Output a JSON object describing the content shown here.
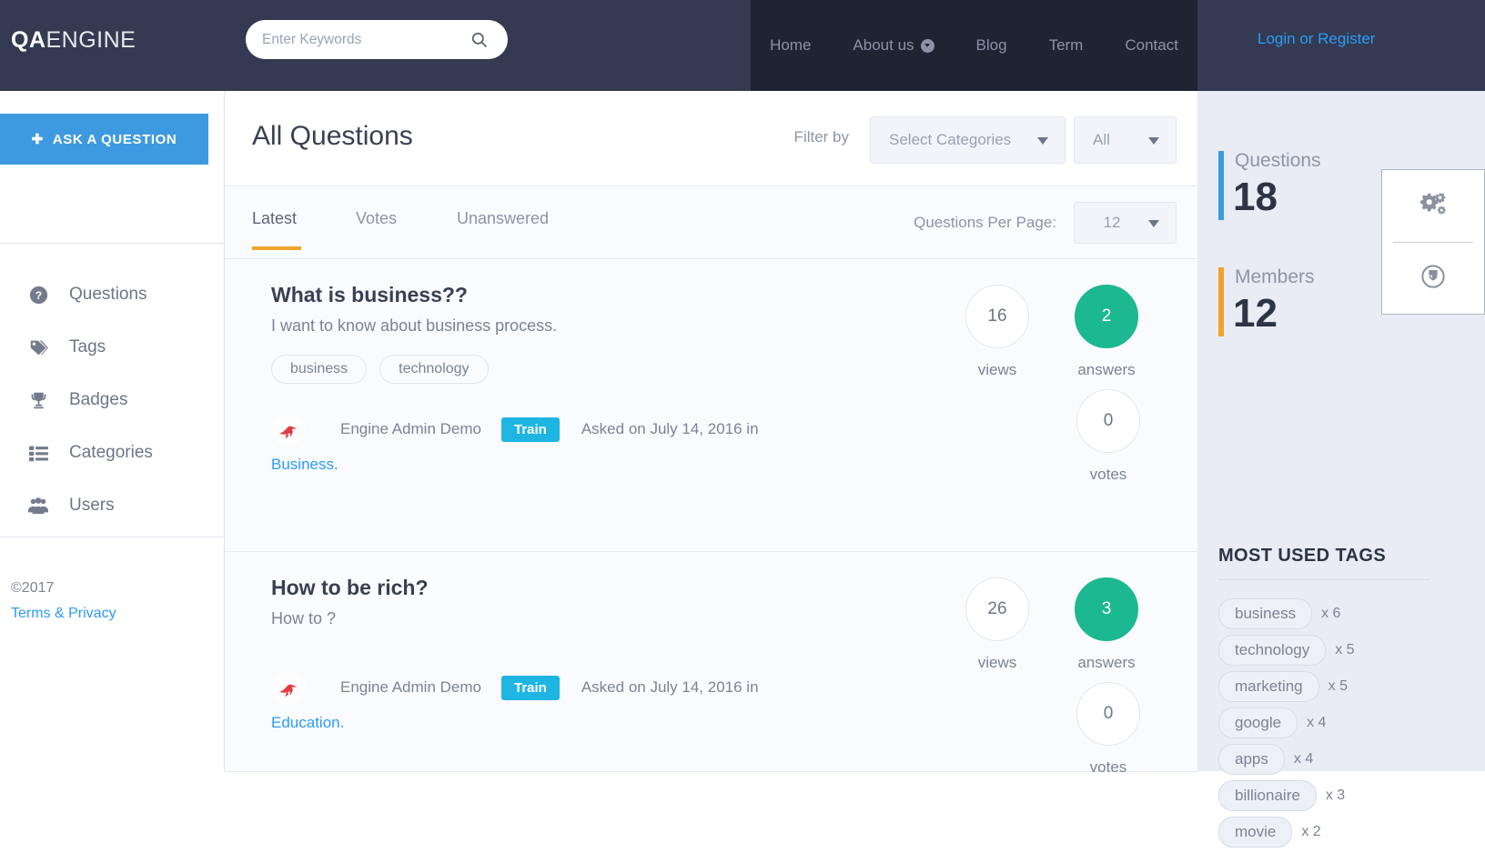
{
  "header": {
    "logo_qa": "QA",
    "logo_engine": "ENGINE",
    "search_placeholder": "Enter Keywords",
    "search_value": "",
    "search_icon": "search-icon",
    "nav": [
      {
        "label": "Home",
        "has_caret": false
      },
      {
        "label": "About us",
        "has_caret": true
      },
      {
        "label": "Blog",
        "has_caret": false
      },
      {
        "label": "Term",
        "has_caret": false
      },
      {
        "label": "Contact",
        "has_caret": false
      }
    ],
    "login_label": "Login or Register",
    "bg_color": "#343a51",
    "nav_bg_color": "#1f2433",
    "login_color": "#2b9cf5"
  },
  "sidebar": {
    "ask_button": "ASK A QUESTION",
    "ask_plus": "✚",
    "ask_color": "#3d9ae0",
    "items": [
      {
        "label": "Questions",
        "icon": "question-circle-icon"
      },
      {
        "label": "Tags",
        "icon": "tag-icon"
      },
      {
        "label": "Badges",
        "icon": "trophy-icon"
      },
      {
        "label": "Categories",
        "icon": "list-icon"
      },
      {
        "label": "Users",
        "icon": "users-icon"
      }
    ],
    "copyright": "©2017",
    "terms": "Terms & Privacy"
  },
  "main": {
    "title": "All Questions",
    "filter_by_label": "Filter by",
    "select_categories": "Select Categories",
    "select_all": "All",
    "tabs": [
      {
        "label": "Latest",
        "active": true
      },
      {
        "label": "Votes",
        "active": false
      },
      {
        "label": "Unanswered",
        "active": false
      }
    ],
    "active_tab_color": "#f0a42b",
    "questions_per_page_label": "Questions Per Page:",
    "questions_per_page_value": "12",
    "questions": [
      {
        "title": "What is business??",
        "excerpt": "I want to know about business process.",
        "tags": [
          "business",
          "technology"
        ],
        "author": "Engine Admin Demo",
        "badge": "Train",
        "asked": "Asked on July 14, 2016 in",
        "category": "Business.",
        "views": "16",
        "views_label": "views",
        "answers": "2",
        "answers_label": "answers",
        "votes": "0",
        "votes_label": "votes",
        "answers_highlight": true
      },
      {
        "title": "How to be rich?",
        "excerpt": "How to ?",
        "tags": [],
        "author": "Engine Admin Demo",
        "badge": "Train",
        "asked": "Asked on July 14, 2016 in",
        "category": "Education.",
        "views": "26",
        "views_label": "views",
        "answers": "3",
        "answers_label": "answers",
        "votes": "0",
        "votes_label": "votes",
        "answers_highlight": true
      }
    ],
    "answer_badge_color": "#1cb891",
    "train_badge_color": "#1eb5e3"
  },
  "right_sidebar": {
    "stats": [
      {
        "name": "Questions",
        "value": "18",
        "bar_color": "#3d9ae0"
      },
      {
        "name": "Members",
        "value": "12",
        "bar_color": "#f0a42b"
      }
    ],
    "tags_title": "MOST USED TAGS",
    "tags": [
      {
        "label": "business",
        "count": "x 6"
      },
      {
        "label": "technology",
        "count": "x 5"
      },
      {
        "label": "marketing",
        "count": "x 5"
      },
      {
        "label": "google",
        "count": "x 4"
      },
      {
        "label": "apps",
        "count": "x 4"
      },
      {
        "label": "billionaire",
        "count": "x 3"
      },
      {
        "label": "movie",
        "count": "x 2"
      }
    ]
  },
  "float_panel": {
    "buttons": [
      {
        "icon": "gears-icon",
        "name": "settings"
      },
      {
        "icon": "download-circle-icon",
        "name": "download"
      }
    ]
  }
}
